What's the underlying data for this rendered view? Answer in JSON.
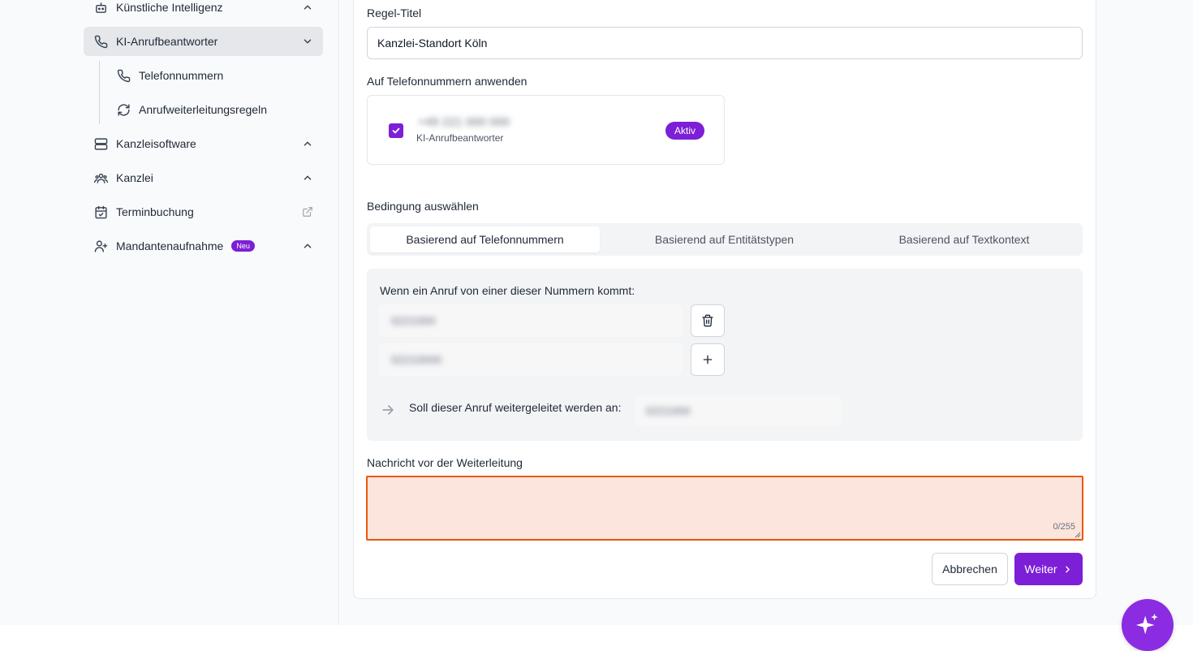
{
  "sidebar": {
    "items": [
      {
        "label": "Künstliche Intelligenz",
        "icon": "robot-icon",
        "chevron": "up"
      },
      {
        "label": "KI-Anrufbeantworter",
        "icon": "phone-icon",
        "chevron": "down",
        "active": true
      },
      {
        "label": "Kanzleisoftware",
        "icon": "server-icon",
        "chevron": "up"
      },
      {
        "label": "Kanzlei",
        "icon": "users-icon",
        "chevron": "up"
      },
      {
        "label": "Terminbuchung",
        "icon": "calendar-check-icon",
        "trailing": "external-link-icon"
      },
      {
        "label": "Mandantenaufnahme",
        "icon": "user-plus-icon",
        "badge": "Neu",
        "chevron": "up"
      }
    ],
    "subitems": [
      {
        "label": "Telefonnummern",
        "icon": "phone-icon"
      },
      {
        "label": "Anrufweiterleitungsregeln",
        "icon": "refresh-icon"
      }
    ]
  },
  "form": {
    "title_label": "Regel-Titel",
    "title_value": "Kanzlei-Standort Köln",
    "apply_label": "Auf Telefonnummern anwenden",
    "phone_card": {
      "number": "+49 221 000 000",
      "subtitle": "KI-Anrufbeantworter",
      "status": "Aktiv",
      "checked": true
    },
    "condition_label": "Bedingung auswählen",
    "tabs": [
      "Basierend auf Telefonnummern",
      "Basierend auf Entitätstypen",
      "Basierend auf Textkontext"
    ],
    "active_tab": 0,
    "condition": {
      "heading": "Wenn ein Anruf von einer dieser Nummern kommt:",
      "numbers": [
        "0221000",
        "02210000"
      ],
      "forward_label": "Soll dieser Anruf weitergeleitet werden an:",
      "forward_value": "0221000"
    },
    "message_label": "Nachricht vor der Weiterleitung",
    "message_value": "",
    "message_counter": "0/255",
    "cancel_label": "Abbrechen",
    "next_label": "Weiter"
  },
  "colors": {
    "accent": "#7c1fd6",
    "error_border": "#ea580c",
    "error_bg": "#fbe5dc"
  }
}
